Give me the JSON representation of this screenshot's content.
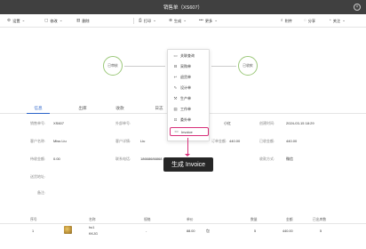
{
  "window": {
    "title": "销售单（XS607）"
  },
  "toolbar": {
    "settings": "设置",
    "edit": "修改",
    "delete": "删除",
    "print": "打印",
    "generate": "生成",
    "more": "更多",
    "attachment": "附件",
    "share": "分享",
    "follow": "关注"
  },
  "flow": {
    "step_done": "已审核",
    "step_receive": "已收款"
  },
  "tabs": [
    "信息",
    "出库",
    "收款",
    "日志"
  ],
  "dropdown": {
    "items": [
      {
        "icon": "folder-icon",
        "glyph": "▭",
        "label": "关联查询"
      },
      {
        "icon": "cart-icon",
        "glyph": "⊟",
        "label": "采购单"
      },
      {
        "icon": "return-icon",
        "glyph": "↩",
        "label": "退货单"
      },
      {
        "icon": "design-icon",
        "glyph": "✎",
        "label": "设计单"
      },
      {
        "icon": "production-icon",
        "glyph": "⚒",
        "label": "生产单"
      },
      {
        "icon": "work-order-icon",
        "glyph": "▤",
        "label": "工作单"
      },
      {
        "icon": "ship-icon",
        "glyph": "⊡",
        "label": "委外单"
      },
      {
        "icon": "invoice-icon",
        "glyph": "▭",
        "label": "Invoice"
      }
    ]
  },
  "callout": {
    "text": "生成 Invoice"
  },
  "fields": {
    "order_no_label": "销售单号:",
    "order_no": "XS607",
    "outer_no_label": "外部单号:",
    "customer_name_label": "客户名称:",
    "customer_name": "Miss Liu",
    "customer_contact_label": "客户详情:",
    "customer_contact": "Liu",
    "small_label": "小红",
    "create_time_label": "创建时间:",
    "create_time": "2024-03-15 18:29",
    "order_amount_label": "订单金额:",
    "order_amount": "440.00",
    "paid_label": "已收金额:",
    "paid": "440.00",
    "pending_label": "待收金额:",
    "pending": "0.00",
    "phone_label": "联系电话:",
    "phone": "18668686868",
    "payment_label": "收款方式:",
    "payment": "微信",
    "address_label": "送货地址:",
    "remark_label": "备注:"
  },
  "table": {
    "headers": [
      "序号",
      "名称",
      "规格",
      "单价",
      "数量",
      "金额",
      "已出库数"
    ],
    "rows": [
      {
        "index": "1",
        "name": "hu1",
        "name2": "KKJG",
        "spec": "-",
        "price": "88.00",
        "unit": "包",
        "qty": "5",
        "amount": "440.00",
        "shipped": "5"
      }
    ]
  }
}
